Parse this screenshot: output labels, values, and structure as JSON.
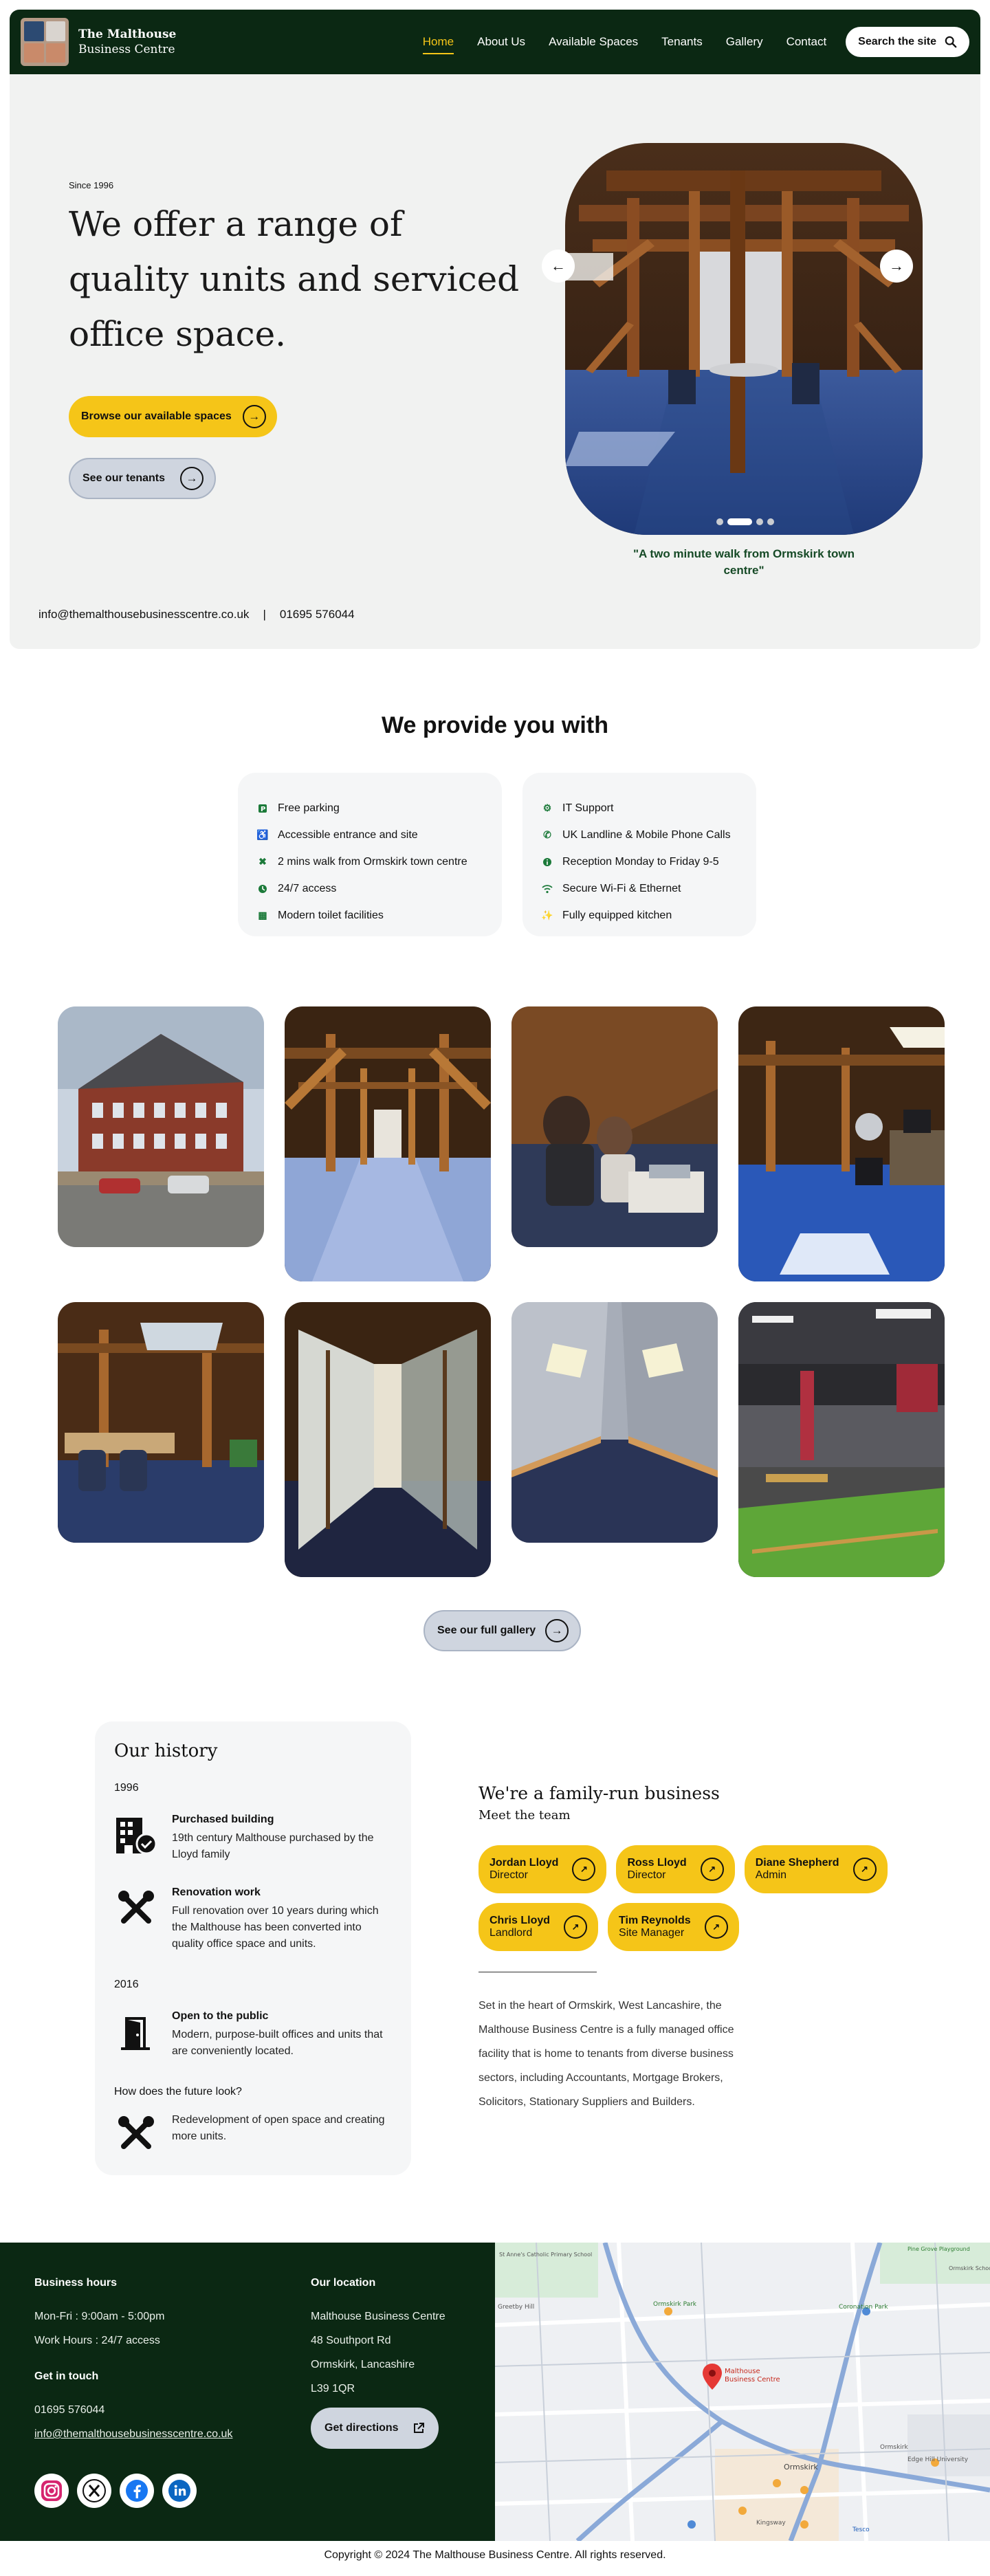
{
  "header": {
    "logo_line1": "The Malthouse",
    "logo_line2": "Business Centre",
    "nav": [
      "Home",
      "About Us",
      "Available Spaces",
      "Tenants",
      "Gallery",
      "Contact"
    ],
    "active_nav": "Home",
    "search_label": "Search the site"
  },
  "hero": {
    "since": "Since 1996",
    "title": "We offer a range of quality units and serviced office space.",
    "primary_button": "Browse our available spaces",
    "secondary_button": "See our tenants",
    "caption": "\"A two minute walk from Ormskirk town centre\"",
    "slide_count": 4,
    "active_slide": 2,
    "email": "info@themalthousebusinesscentre.co.uk",
    "separator": "|",
    "phone": "01695 576044"
  },
  "provide": {
    "title": "We provide you with",
    "left": [
      {
        "icon": "parking-icon",
        "label": "Free parking"
      },
      {
        "icon": "accessible-icon",
        "label": "Accessible entrance and site"
      },
      {
        "icon": "walking-icon",
        "label": "2 mins walk from Ormskirk town centre"
      },
      {
        "icon": "clock-icon",
        "label": "24/7 access"
      },
      {
        "icon": "toilet-icon",
        "label": "Modern toilet facilities"
      }
    ],
    "right": [
      {
        "icon": "support-icon",
        "label": "IT Support"
      },
      {
        "icon": "phone-icon",
        "label": "UK Landline & Mobile Phone Calls"
      },
      {
        "icon": "info-icon",
        "label": "Reception Monday to Friday 9-5"
      },
      {
        "icon": "wifi-icon",
        "label": "Secure Wi-Fi & Ethernet"
      },
      {
        "icon": "kitchen-icon",
        "label": "Fully equipped kitchen"
      }
    ]
  },
  "gallery": {
    "button": "See our full gallery"
  },
  "history": {
    "title": "Our history",
    "year1": "1996",
    "item1_title": "Purchased building",
    "item1_text": "19th century Malthouse purchased by the Lloyd family",
    "item2_title": "Renovation work",
    "item2_text": "Full renovation over 10 years during which the Malthouse has been converted into quality office space and units.",
    "year2": "2016",
    "item3_title": "Open to the public",
    "item3_text": "Modern, purpose-built offices and units that are conveniently located.",
    "future": "How does the future look?",
    "item4_text": "Redevelopment of open space and creating more units."
  },
  "family": {
    "title": "We're a family-run business",
    "subtitle": "Meet the team",
    "team": [
      {
        "name": "Jordan Lloyd",
        "role": "Director"
      },
      {
        "name": "Ross Lloyd",
        "role": "Director"
      },
      {
        "name": "Diane Shepherd",
        "role": "Admin"
      },
      {
        "name": "Chris Lloyd",
        "role": "Landlord"
      },
      {
        "name": "Tim Reynolds",
        "role": "Site Manager"
      }
    ],
    "paragraph": "Set in the heart of Ormskirk, West Lancashire, the Malthouse Business Centre is a fully managed office facility that is home to tenants from diverse business sectors, including Accountants, Mortgage Brokers, Solicitors, Stationary Suppliers and Builders."
  },
  "footer": {
    "hours_title": "Business hours",
    "hours_weekday": "Mon-Fri : 9:00am - 5:00pm",
    "hours_work": "Work Hours : 24/7 access",
    "touch_title": "Get in touch",
    "phone": "01695 576044",
    "email": "info@themalthousebusinesscentre.co.uk",
    "location_title": "Our location",
    "address1": "Malthouse Business Centre",
    "address2": "48 Southport Rd",
    "address3": "Ormskirk, Lancashire",
    "address4": "L39 1QR",
    "directions_button": "Get directions",
    "socials": [
      "instagram-icon",
      "x-icon",
      "facebook-icon",
      "linkedin-icon"
    ],
    "map": {
      "pin_label_1": "Malthouse",
      "pin_label_2": "Business Centre",
      "places": [
        "Ormskirk",
        "Ormskirk Park",
        "Coronation Park",
        "Ormskirk",
        "Edge Hill University",
        "Greetby Hill",
        "St Anne's Catholic Primary School",
        "Ormskirk School",
        "Pine Grove Playground",
        "Tesco",
        "Kingsway"
      ]
    },
    "copyright": "Copyright © 2024 The Malthouse Business Centre. All rights reserved."
  },
  "colors": {
    "brand_dark_green": "#0b2813",
    "accent_yellow": "#f5c518",
    "hero_bg": "#f1f2f1"
  }
}
